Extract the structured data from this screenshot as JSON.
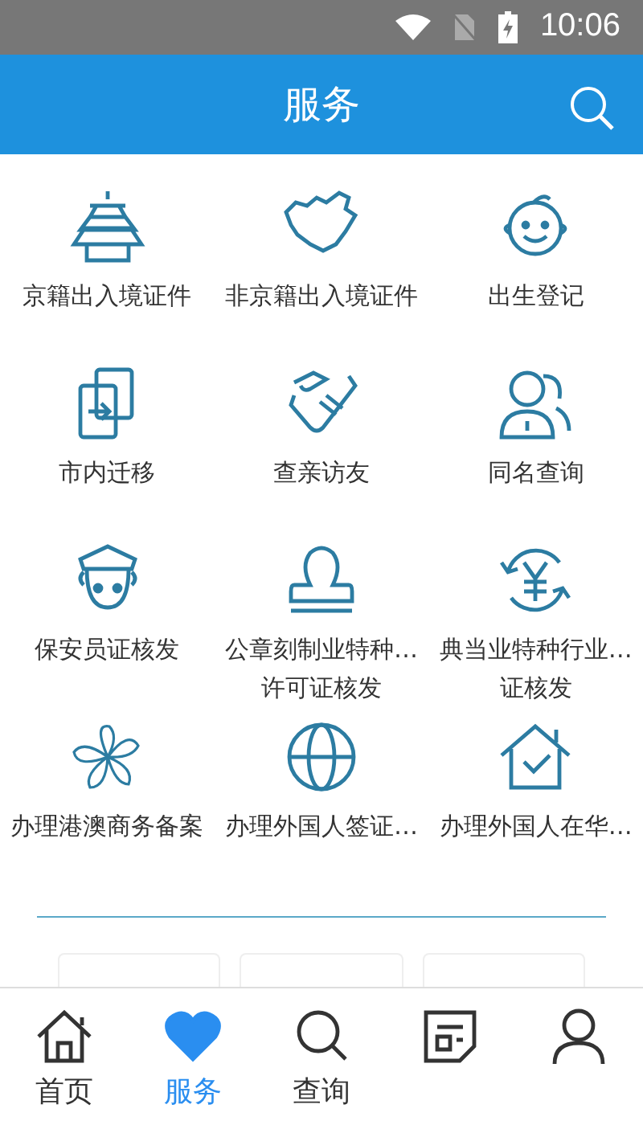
{
  "status_bar": {
    "time": "10:06"
  },
  "header": {
    "title": "服务"
  },
  "services": [
    {
      "label": "京籍出入境证件"
    },
    {
      "label": "非京籍出入境证件"
    },
    {
      "label": "出生登记"
    },
    {
      "label": "市内迁移"
    },
    {
      "label": "查亲访友"
    },
    {
      "label": "同名查询"
    },
    {
      "label": "保安员证核发"
    },
    {
      "label": "公章刻制业特种…\n许可证核发"
    },
    {
      "label": "典当业特种行业…\n证核发"
    },
    {
      "label": "办理港澳商务备案"
    },
    {
      "label": "办理外国人签证…"
    },
    {
      "label": "办理外国人在华…"
    }
  ],
  "bottom_nav": [
    {
      "label": "首页",
      "selected": false
    },
    {
      "label": "服务",
      "selected": true
    },
    {
      "label": "查询",
      "selected": false
    },
    {
      "selected": false
    },
    {
      "selected": false
    }
  ]
}
